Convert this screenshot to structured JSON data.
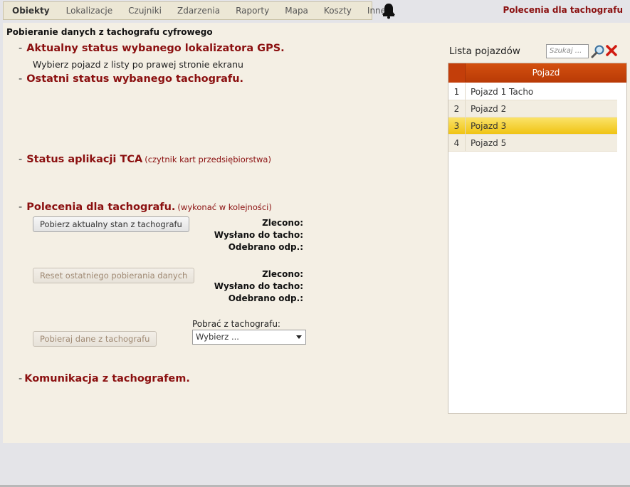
{
  "nav": {
    "items": [
      "Obiekty",
      "Lokalizacje",
      "Czujniki",
      "Zdarzenia",
      "Raporty",
      "Mapa",
      "Koszty",
      "Inne"
    ],
    "active": "Obiekty"
  },
  "header": {
    "title": "Polecenia dla tachografu"
  },
  "page": {
    "title": "Pobieranie danych z tachografu cyfrowego"
  },
  "sections": {
    "gps": {
      "title": "Aktualny status wybanego lokalizatora GPS.",
      "hint": "Wybierz pojazd z listy po prawej stronie ekranu"
    },
    "last": {
      "title": "Ostatni status wybanego tachografu."
    },
    "tca": {
      "title": "Status aplikacji TCA",
      "note": "(czytnik kart przedsiębiorstwa)"
    },
    "commands": {
      "title": "Polecenia dla tachografu.",
      "note": "(wykonać w kolejności)"
    },
    "comm": {
      "title": "Komunikacja z tachografem."
    },
    "dash": "-"
  },
  "commands": {
    "btn_fetch_state": "Pobierz aktualny stan z tachografu",
    "btn_reset": "Reset ostatniego pobierania danych",
    "btn_fetch_data": "Pobieraj dane z tachografu",
    "labels": {
      "ordered": "Zlecono:",
      "sent": "Wysłano do tacho:",
      "received": "Odebrano odp.:"
    },
    "fetch_label": "Pobrać z tachografu:",
    "fetch_select": "Wybierz ..."
  },
  "vehicles": {
    "title": "Lista pojazdów",
    "search_placeholder": "Szukaj ...",
    "column": "Pojazd",
    "rows": [
      {
        "n": "1",
        "name": "Pojazd 1 Tacho"
      },
      {
        "n": "2",
        "name": "Pojazd 2"
      },
      {
        "n": "3",
        "name": "Pojazd 3"
      },
      {
        "n": "4",
        "name": "Pojazd 5"
      }
    ],
    "selected": "3"
  },
  "colors": {
    "accent": "#8b1010",
    "header_orange": "#c33e0a",
    "selected_row": "#f0c414"
  }
}
